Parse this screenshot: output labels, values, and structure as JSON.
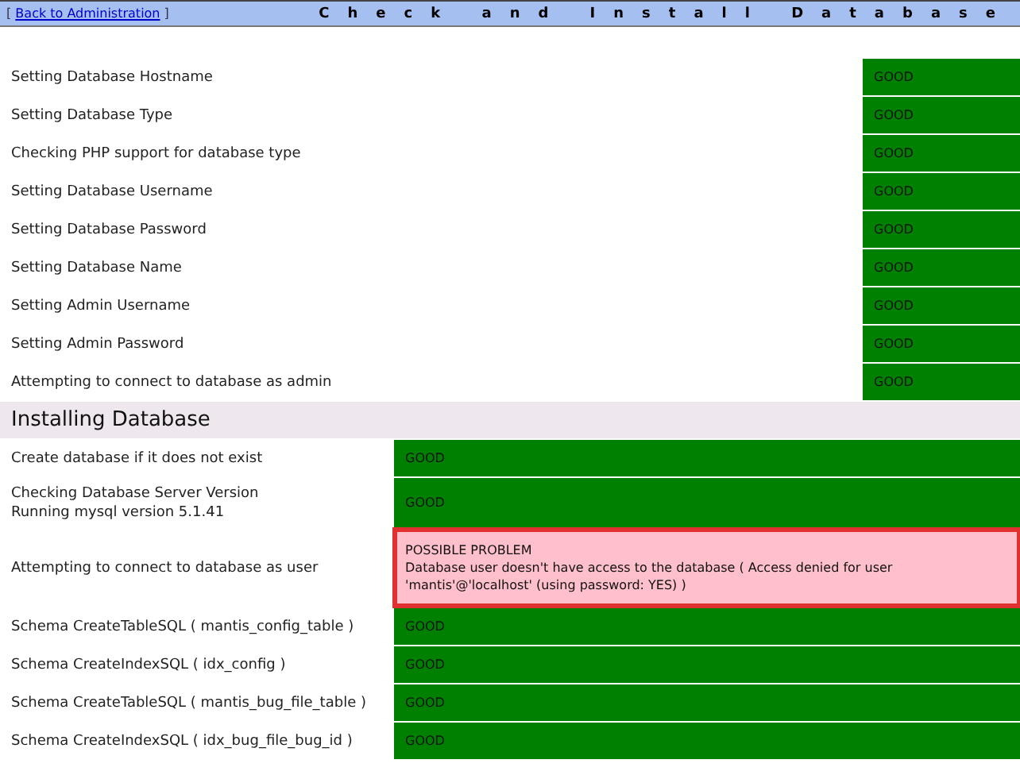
{
  "header": {
    "bracket_open": "[",
    "back_link": "Back to Administration",
    "bracket_close": "]",
    "title": "Check and Install Database"
  },
  "checks": [
    {
      "label": [
        "Setting Database Hostname"
      ],
      "kind": "good",
      "status": "GOOD"
    },
    {
      "label": [
        "Setting Database Type"
      ],
      "kind": "good",
      "status": "GOOD"
    },
    {
      "label": [
        "Checking PHP support for database type"
      ],
      "kind": "good",
      "status": "GOOD"
    },
    {
      "label": [
        "Setting Database Username"
      ],
      "kind": "good",
      "status": "GOOD"
    },
    {
      "label": [
        "Setting Database Password"
      ],
      "kind": "good",
      "status": "GOOD"
    },
    {
      "label": [
        "Setting Database Name"
      ],
      "kind": "good",
      "status": "GOOD"
    },
    {
      "label": [
        "Setting Admin Username"
      ],
      "kind": "good",
      "status": "GOOD"
    },
    {
      "label": [
        "Setting Admin Password"
      ],
      "kind": "good",
      "status": "GOOD"
    },
    {
      "label": [
        "Attempting to connect to database as admin"
      ],
      "kind": "good",
      "status": "GOOD"
    }
  ],
  "install_section": {
    "title": "Installing Database",
    "rows": [
      {
        "label": [
          "Create database if it does not exist"
        ],
        "kind": "good",
        "status": "GOOD"
      },
      {
        "label": [
          "Checking Database Server Version",
          "Running mysql version 5.1.41"
        ],
        "kind": "good",
        "status": "GOOD"
      },
      {
        "label": [
          "Attempting to connect to database as user"
        ],
        "kind": "problem",
        "status": "POSSIBLE PROBLEM",
        "message": "Database user doesn't have access to the database ( Access denied for user 'mantis'@'localhost' (using password: YES) )"
      },
      {
        "label": [
          "Schema CreateTableSQL ( mantis_config_table )"
        ],
        "kind": "good",
        "status": "GOOD"
      },
      {
        "label": [
          "Schema CreateIndexSQL ( idx_config )"
        ],
        "kind": "good",
        "status": "GOOD"
      },
      {
        "label": [
          "Schema CreateTableSQL ( mantis_bug_file_table )"
        ],
        "kind": "good",
        "status": "GOOD"
      },
      {
        "label": [
          "Schema CreateIndexSQL ( idx_bug_file_bug_id )"
        ],
        "kind": "good",
        "status": "GOOD"
      }
    ]
  }
}
